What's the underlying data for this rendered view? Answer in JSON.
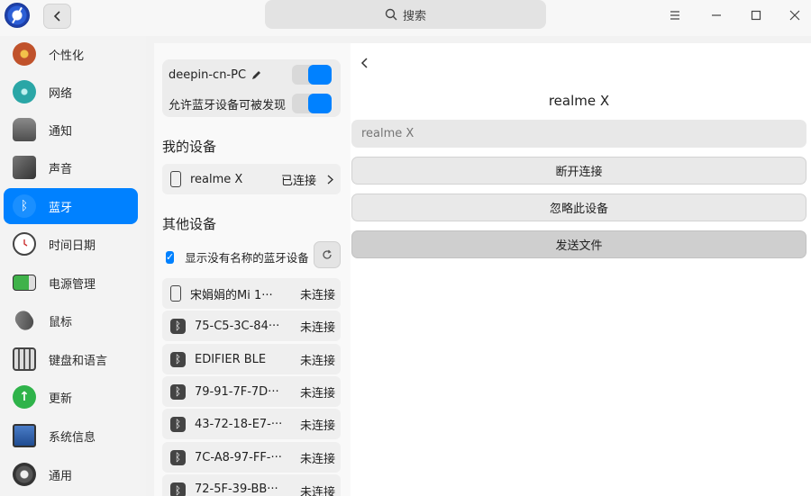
{
  "titlebar": {
    "search_label": "搜索",
    "icons": [
      "app-logo",
      "back-chevron",
      "search-icon",
      "menu-icon",
      "minimize-icon",
      "maximize-icon",
      "close-icon"
    ]
  },
  "sidebar": {
    "items": [
      {
        "label": "个性化",
        "icon": "personalization-icon",
        "color": "#c0522b"
      },
      {
        "label": "网络",
        "icon": "network-icon",
        "color": "#2aa6a6"
      },
      {
        "label": "通知",
        "icon": "bell-icon",
        "color": "#6a6a6a"
      },
      {
        "label": "声音",
        "icon": "speaker-icon",
        "color": "#555555"
      },
      {
        "label": "蓝牙",
        "icon": "bluetooth-icon",
        "color": "#0081ff",
        "active": true
      },
      {
        "label": "时间日期",
        "icon": "clock-icon",
        "color": "#444444"
      },
      {
        "label": "电源管理",
        "icon": "battery-icon",
        "color": "#3fb24a"
      },
      {
        "label": "鼠标",
        "icon": "mouse-icon",
        "color": "#666666"
      },
      {
        "label": "键盘和语言",
        "icon": "keyboard-icon",
        "color": "#555555"
      },
      {
        "label": "更新",
        "icon": "update-icon",
        "color": "#2fb34a"
      },
      {
        "label": "系统信息",
        "icon": "system-info-icon",
        "color": "#3366aa"
      },
      {
        "label": "通用",
        "icon": "general-icon",
        "color": "#555555"
      }
    ]
  },
  "bluetooth": {
    "device_name": "deepin-cn-PC",
    "discoverable_label": "允许蓝牙设备可被发现",
    "my_devices_title": "我的设备",
    "my_devices": [
      {
        "name": "realme X",
        "status": "已连接"
      }
    ],
    "other_devices_title": "其他设备",
    "show_unnamed_label": "显示没有名称的蓝牙设备",
    "other_devices": [
      {
        "name": "宋娟娟的Mi 1···",
        "status": "未连接",
        "icon": "phone"
      },
      {
        "name": "75-C5-3C-84···",
        "status": "未连接",
        "icon": "bluetooth"
      },
      {
        "name": "EDIFIER BLE",
        "status": "未连接",
        "icon": "bluetooth"
      },
      {
        "name": "79-91-7F-7D···",
        "status": "未连接",
        "icon": "bluetooth"
      },
      {
        "name": "43-72-18-E7-···",
        "status": "未连接",
        "icon": "bluetooth"
      },
      {
        "name": "7C-A8-97-FF-···",
        "status": "未连接",
        "icon": "bluetooth"
      },
      {
        "name": "72-5F-39-BB···",
        "status": "未连接",
        "icon": "bluetooth"
      }
    ]
  },
  "detail": {
    "title": "realme X",
    "name_placeholder": "realme X",
    "disconnect_label": "断开连接",
    "ignore_label": "忽略此设备",
    "send_file_label": "发送文件"
  },
  "colors": {
    "accent": "#0081ff",
    "sidebar_bg": "#f3f3f3"
  }
}
